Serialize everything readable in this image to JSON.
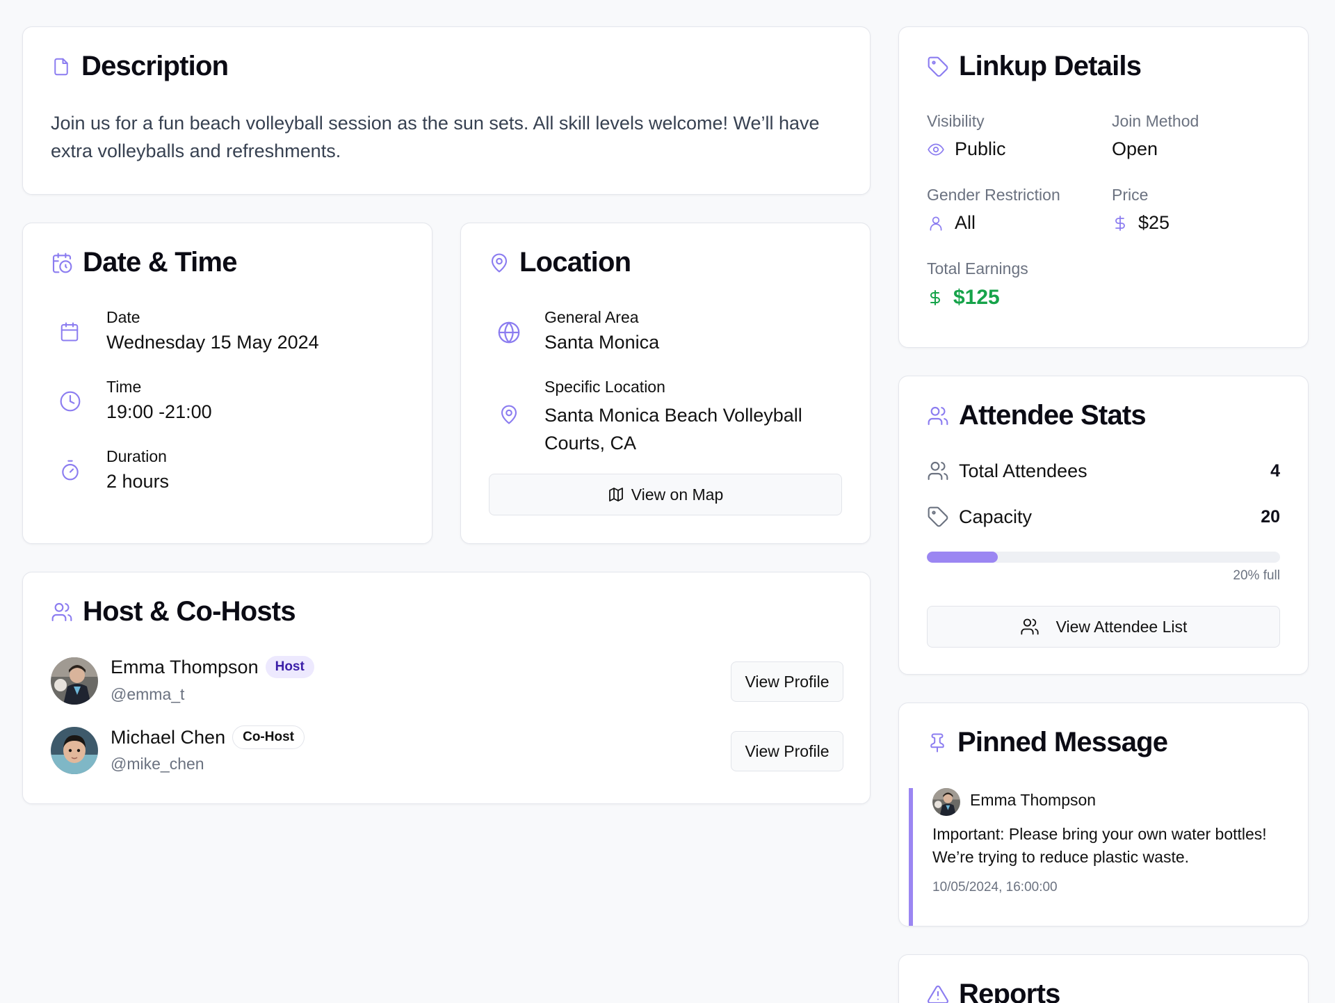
{
  "description": {
    "title": "Description",
    "text": "Join us for a fun beach volleyball session as the sun sets. All skill levels welcome! We’ll have extra volleyballs and refreshments."
  },
  "datetime": {
    "title": "Date & Time",
    "date_label": "Date",
    "date_value": "Wednesday 15 May 2024",
    "time_label": "Time",
    "time_value": "19:00 -21:00",
    "duration_label": "Duration",
    "duration_value": "2 hours"
  },
  "location": {
    "title": "Location",
    "general_label": "General Area",
    "general_value": "Santa Monica",
    "specific_label": "Specific Location",
    "specific_value": "Santa Monica Beach Volleyball Courts, CA",
    "map_button": "View on Map"
  },
  "hosts": {
    "title": "Host & Co-Hosts",
    "list": [
      {
        "name": "Emma Thompson",
        "role": "Host",
        "handle": "@emma_t",
        "button": "View Profile"
      },
      {
        "name": "Michael Chen",
        "role": "Co-Host",
        "handle": "@mike_chen",
        "button": "View Profile"
      }
    ]
  },
  "linkup": {
    "title": "Linkup Details",
    "visibility_label": "Visibility",
    "visibility_value": "Public",
    "join_label": "Join Method",
    "join_value": "Open",
    "gender_label": "Gender Restriction",
    "gender_value": "All",
    "price_label": "Price",
    "price_value": "$25",
    "earnings_label": "Total Earnings",
    "earnings_value": "$125"
  },
  "stats": {
    "title": "Attendee Stats",
    "attendees_label": "Total Attendees",
    "attendees_value": "4",
    "capacity_label": "Capacity",
    "capacity_value": "20",
    "fill_fraction": 0.2,
    "fill_text": "20% full",
    "list_button": "View Attendee List"
  },
  "pinned": {
    "title": "Pinned Message",
    "author": "Emma Thompson",
    "message": "Important: Please bring your own water bottles! We’re trying to reduce plastic waste.",
    "timestamp": "10/05/2024, 16:00:00"
  },
  "reports": {
    "title": "Reports"
  },
  "colors": {
    "accent": "#8b7cf0",
    "green": "#16a34a",
    "host_badge_bg": "#ede9fe",
    "host_badge_text": "#3b1fa8"
  },
  "icons": {
    "description": "file-icon",
    "datetime": "calendar-clock-icon",
    "location": "map-pin-icon",
    "hosts": "users-icon",
    "linkup": "tag-icon",
    "stats": "users-icon",
    "pinned": "pin-icon",
    "reports": "alert-triangle-icon"
  }
}
